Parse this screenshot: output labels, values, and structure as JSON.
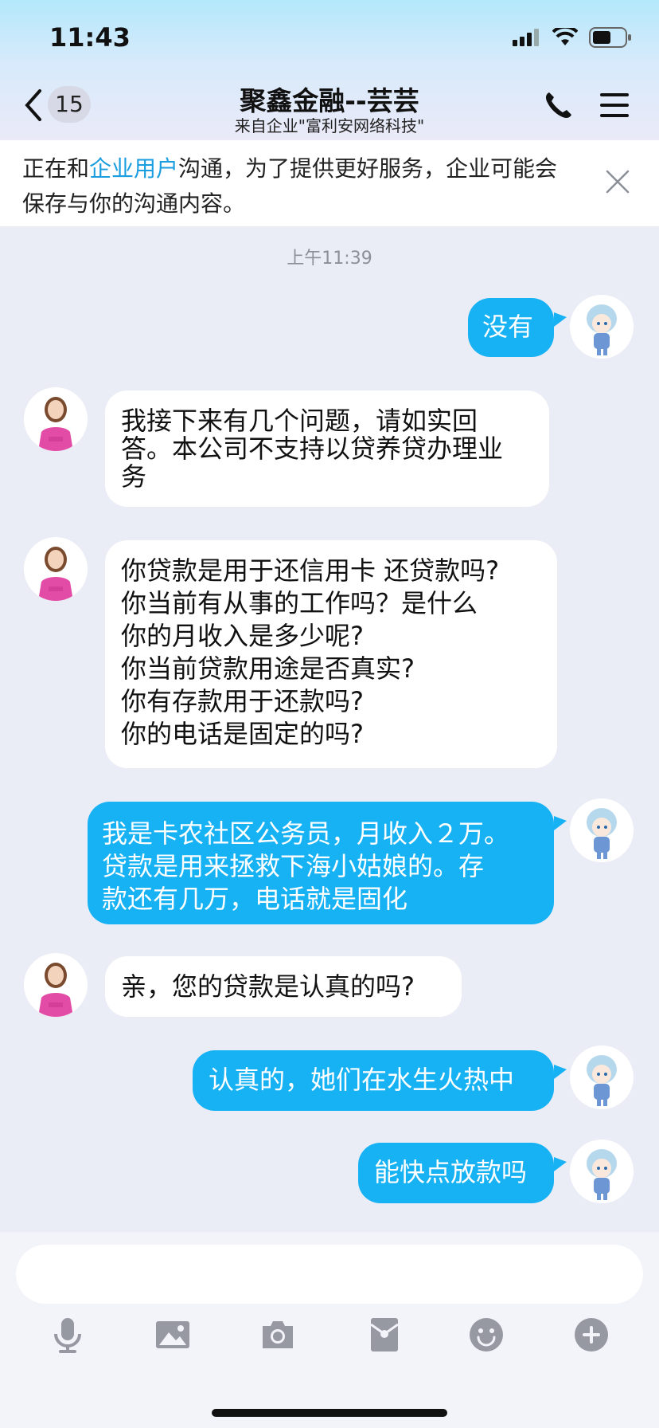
{
  "status_bar": {
    "time": "11:43",
    "icons": [
      "signal-icon",
      "wifi-icon",
      "battery-icon"
    ]
  },
  "nav": {
    "unread_count": "15",
    "title": "聚鑫金融--芸芸",
    "subtitle": "来自企业\"富利安网络科技\"",
    "icons": [
      "back-chevron-icon",
      "phone-icon",
      "menu-icon"
    ]
  },
  "notice": {
    "prefix": "正在和",
    "link": "企业用户",
    "suffix": "沟通，为了提供更好服务，企业可能会保存与你的沟通内容。"
  },
  "chat": {
    "timestamp": "上午11:39",
    "messages": [
      {
        "from": "me",
        "text": "没有"
      },
      {
        "from": "agent",
        "lines": [
          "我接下来有几个问题，请如实回",
          "答。本公司不支持以贷养贷办理业",
          "务"
        ]
      },
      {
        "from": "agent",
        "lines": [
          "你贷款是用于还信用卡 还贷款吗?",
          "你当前有从事的工作吗？是什么",
          "你的月收入是多少呢?",
          "你当前贷款用途是否真实?",
          "你有存款用于还款吗?",
          "你的电话是固定的吗?"
        ]
      },
      {
        "from": "me",
        "lines": [
          "我是卡农社区公务员，月收入２万。",
          "贷款是用来拯救下海小姑娘的。存",
          "款还有几万，电话就是固化"
        ]
      },
      {
        "from": "agent",
        "text": "亲，您的贷款是认真的吗?"
      },
      {
        "from": "me",
        "text": "认真的，她们在水生火热中"
      },
      {
        "from": "me",
        "text": "能快点放款吗"
      }
    ]
  },
  "toolbar": {
    "icons": [
      "microphone-icon",
      "image-icon",
      "camera-icon",
      "red-packet-icon",
      "emoji-icon",
      "plus-icon"
    ]
  },
  "colors": {
    "my_bubble": "#17b2f4",
    "their_bubble": "#ffffff",
    "link": "#1a9ee0",
    "background": "#ebedf6"
  }
}
